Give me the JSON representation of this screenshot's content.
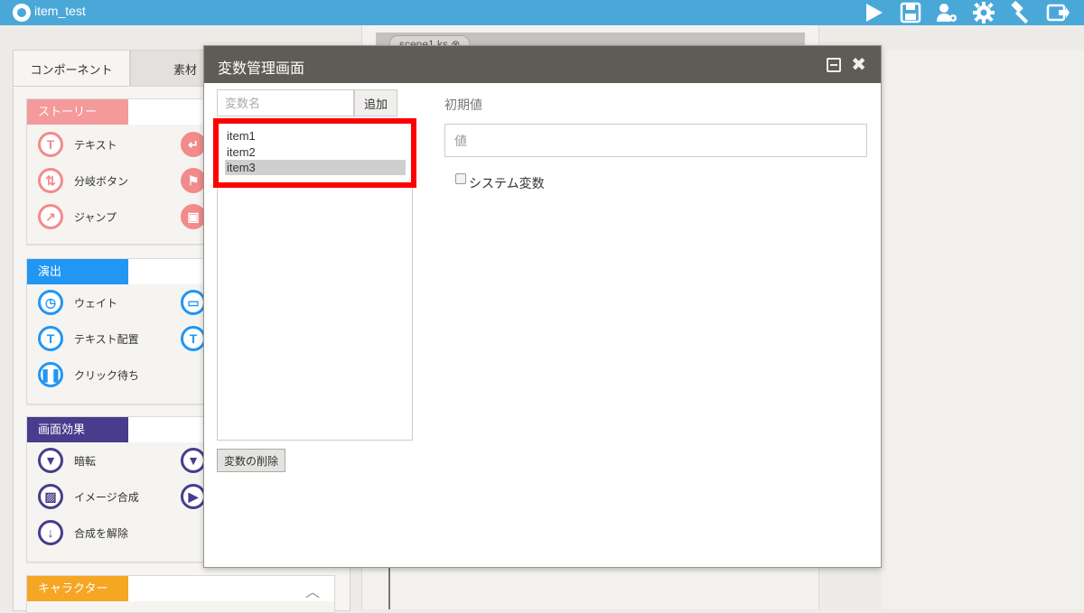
{
  "app": {
    "title": "item_test"
  },
  "left_panel": {
    "tabs": [
      "コンポーネント",
      "素材"
    ],
    "sections": [
      {
        "label": "ストーリー",
        "color": "#f28b8b",
        "items": [
          "テキスト",
          "分岐ボタン",
          "ジャンプ"
        ]
      },
      {
        "label": "演出",
        "color": "#2196f3",
        "items": [
          "ウェイト",
          "テキスト配置",
          "クリック待ち"
        ]
      },
      {
        "label": "画面効果",
        "color": "#4a3c8c",
        "items": [
          "暗転",
          "イメージ合成",
          "合成を解除"
        ]
      },
      {
        "label": "キャラクター",
        "color": "#f5a623",
        "items": []
      }
    ]
  },
  "editor": {
    "scene_tab": "scene1.ks"
  },
  "dialog": {
    "title": "変数管理画面",
    "name_placeholder": "変数名",
    "add_label": "追加",
    "variables": [
      "item1",
      "item2",
      "item3"
    ],
    "selected_index": 2,
    "delete_label": "変数の削除",
    "initial_label": "初期値",
    "value_placeholder": "値",
    "system_var_label": "システム変数",
    "system_var_checked": false
  },
  "colors": {
    "topbar": "#4aa8d8",
    "dialog_header": "#5f5c55",
    "highlight": "#ff0000"
  }
}
